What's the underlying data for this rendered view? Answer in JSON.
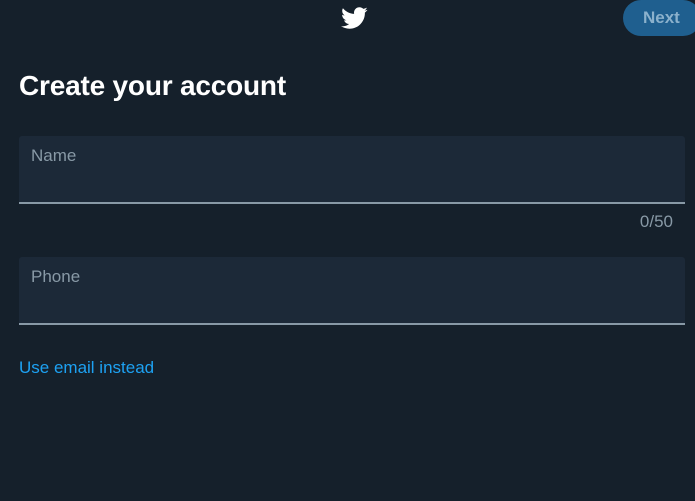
{
  "header": {
    "logo_icon": "twitter-bird-icon",
    "next_label": "Next"
  },
  "page": {
    "title": "Create your account"
  },
  "form": {
    "name": {
      "label": "Name",
      "value": "",
      "counter": "0/50"
    },
    "phone": {
      "label": "Phone",
      "value": ""
    },
    "switch_link": "Use email instead"
  },
  "colors": {
    "background": "#15202b",
    "field_background": "#1c2938",
    "accent": "#1da1f2",
    "muted_text": "#8899a6",
    "next_button_bg": "#1f5f8f"
  }
}
